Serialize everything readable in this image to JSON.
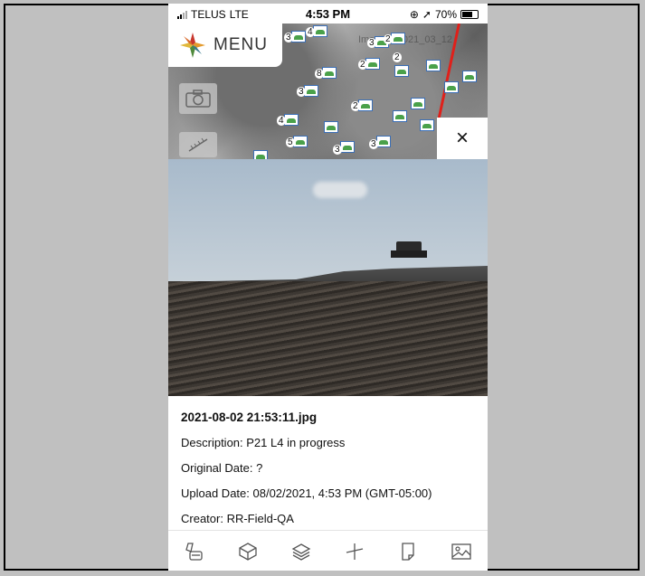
{
  "status_bar": {
    "carrier": "TELUS",
    "network": "LTE",
    "time": "4:53 PM",
    "battery_percent": "70%"
  },
  "map": {
    "menu_label": "MENU",
    "imagery_label": "Imagery 2021_03_12",
    "close_symbol": "×",
    "markers": [
      {
        "count": "3"
      },
      {
        "count": "4"
      },
      {
        "count": "3"
      },
      {
        "count": "2"
      },
      {
        "count": "2"
      },
      {
        "count": "8"
      },
      {
        "count": "3"
      },
      {
        "count": "2"
      },
      {
        "count": "4"
      },
      {
        "count": "5"
      },
      {
        "count": "3"
      },
      {
        "count": "3"
      },
      {
        "count": "2"
      }
    ]
  },
  "photo_info": {
    "filename": "2021-08-02 21:53:11.jpg",
    "description": "Description: P21 L4 in progress",
    "original_date": "Original Date: ?",
    "upload_date": "Upload Date: 08/02/2021, 4:53 PM (GMT-05:00)",
    "creator": "Creator: RR-Field-QA"
  },
  "tabbar": {
    "items": [
      "edit-icon",
      "box-3d-icon",
      "layers-icon",
      "measure-icon",
      "document-icon",
      "image-icon"
    ]
  },
  "colors": {
    "accent_red": "#e0201a",
    "marker_blue": "#3b6fb6",
    "marker_green": "#4aa14a"
  }
}
